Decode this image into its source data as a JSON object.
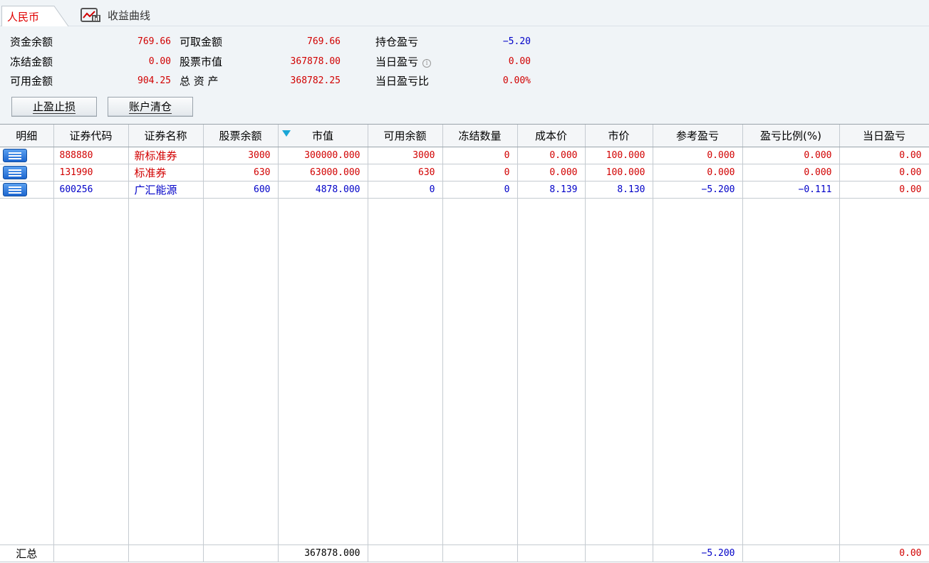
{
  "tabs": {
    "rmb": "人民币",
    "curve": "收益曲线"
  },
  "summary": {
    "fund_balance_label": "资金余额",
    "fund_balance": "769.66",
    "withdrawable_label": "可取金额",
    "withdrawable": "769.66",
    "position_pl_label": "持仓盈亏",
    "position_pl": "−5.20",
    "frozen_label": "冻结金额",
    "frozen": "0.00",
    "stock_value_label": "股票市值",
    "stock_value": "367878.00",
    "daily_pl_label": "当日盈亏",
    "daily_pl": "0.00",
    "available_label": "可用金额",
    "available": "904.25",
    "total_assets_label": "总 资 产",
    "total_assets": "368782.25",
    "daily_pl_ratio_label": "当日盈亏比",
    "daily_pl_ratio": "0.00%",
    "info_icon": "i"
  },
  "buttons": {
    "stop_label": "止盈止损",
    "clear_label": "账户清仓"
  },
  "table": {
    "headers": [
      "明细",
      "证券代码",
      "证券名称",
      "股票余额",
      "市值",
      "可用余额",
      "冻结数量",
      "成本价",
      "市价",
      "参考盈亏",
      "盈亏比例(%)",
      "当日盈亏"
    ],
    "rows": [
      {
        "code": "888880",
        "name": "新标准券",
        "balance": "3000",
        "market_value": "300000.000",
        "available": "3000",
        "frozen": "0",
        "cost": "0.000",
        "price": "100.000",
        "pl": "0.000",
        "pl_ratio": "0.000",
        "daily_pl": "0.00"
      },
      {
        "code": "131990",
        "name": "标准券",
        "balance": "630",
        "market_value": "63000.000",
        "available": "630",
        "frozen": "0",
        "cost": "0.000",
        "price": "100.000",
        "pl": "0.000",
        "pl_ratio": "0.000",
        "daily_pl": "0.00"
      },
      {
        "code": "600256",
        "name": "广汇能源",
        "balance": "600",
        "market_value": "4878.000",
        "available": "0",
        "frozen": "0",
        "cost": "8.139",
        "price": "8.130",
        "pl": "−5.200",
        "pl_ratio": "−0.111",
        "daily_pl": "0.00"
      }
    ],
    "total": {
      "label": "汇总",
      "market_value": "367878.000",
      "pl": "−5.200",
      "daily_pl": "0.00"
    }
  },
  "colors": {
    "gain": "#d10000",
    "loss": "#0000c8",
    "sort_indicator": "#1aa6d6"
  },
  "icons": {
    "detail": "list-detail-icon",
    "curve": "chart-curve-icon",
    "sort": "sort-desc-icon"
  }
}
